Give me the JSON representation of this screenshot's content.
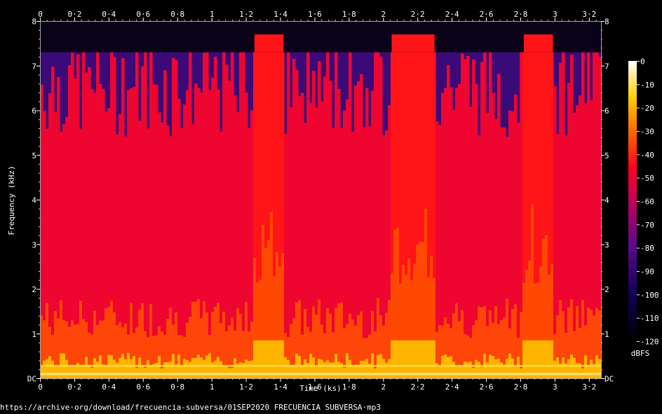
{
  "chart_data": {
    "type": "heatmap",
    "xlabel": "Time (ks)",
    "ylabel": "Frequency (kHz)",
    "xlim": [
      0,
      3.27
    ],
    "ylim": [
      0,
      8
    ],
    "x_ticks": [
      "0",
      "0·2",
      "0·4",
      "0·6",
      "0·8",
      "1",
      "1·2",
      "1·4",
      "1·6",
      "1·8",
      "2",
      "2·2",
      "2·4",
      "2·6",
      "2·8",
      "3",
      "3·2"
    ],
    "x_tick_values": [
      0,
      0.2,
      0.4,
      0.6,
      0.8,
      1.0,
      1.2,
      1.4,
      1.6,
      1.8,
      2.0,
      2.2,
      2.4,
      2.6,
      2.8,
      3.0,
      3.2
    ],
    "y_ticks": [
      "DC",
      "1",
      "2",
      "3",
      "4",
      "5",
      "6",
      "7",
      "8"
    ],
    "y_tick_values": [
      0,
      1,
      2,
      3,
      4,
      5,
      6,
      7,
      8
    ],
    "colorbar": {
      "label": "dBFS",
      "ticks": [
        "0",
        "-10",
        "-20",
        "-30",
        "-40",
        "-50",
        "-60",
        "-70",
        "-80",
        "-90",
        "-100",
        "-110",
        "-120"
      ],
      "tick_values": [
        0,
        -10,
        -20,
        -30,
        -40,
        -50,
        -60,
        -70,
        -80,
        -90,
        -100,
        -110,
        -120
      ],
      "range": [
        -120,
        0
      ]
    },
    "lowpass_cutoff_khz": 7.3,
    "loud_segments_ks": [
      [
        1.25,
        1.42
      ],
      [
        2.05,
        2.3
      ],
      [
        2.82,
        2.99
      ]
    ]
  },
  "footer": {
    "source_url": "https://archive·org/download/frecuencia-subversa/01SEP2020 FRECUENCIA SUBVERSA·mp3"
  }
}
